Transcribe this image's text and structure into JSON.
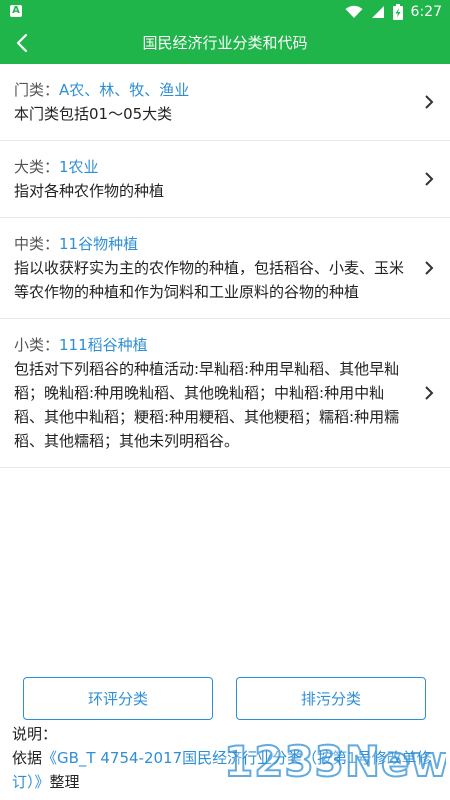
{
  "status_bar": {
    "app_icon_letter": "A",
    "time": "6:27"
  },
  "toolbar": {
    "title": "国民经济行业分类和代码"
  },
  "items": [
    {
      "label": "门类：",
      "value": "A农、林、牧、渔业",
      "desc": "本门类包括01～05大类"
    },
    {
      "label": "大类：",
      "value": "1农业",
      "desc": "指对各种农作物的种植"
    },
    {
      "label": "中类：",
      "value": "11谷物种植",
      "desc": "指以收获籽实为主的农作物的种植，包括稻谷、小麦、玉米等农作物的种植和作为饲料和工业原料的谷物的种植"
    },
    {
      "label": "小类：",
      "value": "111稻谷种植",
      "desc": "包括对下列稻谷的种植活动:早籼稻:种用早籼稻、其他早籼稻；晚籼稻:种用晚籼稻、其他晚籼稻；中籼稻:种用中籼稻、其他中籼稻；粳稻:种用粳稻、其他粳稻；糯稻:种用糯稻、其他糯稻；其他未列明稻谷。"
    }
  ],
  "buttons": {
    "left_label": "环评分类",
    "right_label": "排污分类"
  },
  "note": {
    "heading": "说明：",
    "prefix": "依据",
    "link_text": "《GB_T 4754-2017国民经济行业分类（按第1号修改单修订）》",
    "suffix": "整理"
  },
  "watermark": {
    "text": "1233News"
  },
  "colors": {
    "brand_green": "#1fb54a",
    "link_blue": "#2f8fd4"
  }
}
